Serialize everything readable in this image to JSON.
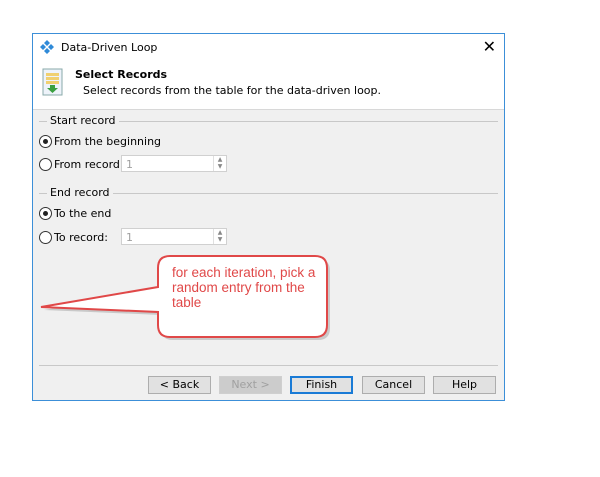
{
  "window": {
    "title": "Data-Driven Loop",
    "close": "✕"
  },
  "header": {
    "title": "Select Records",
    "subtitle": "Select records from the table for the data-driven loop."
  },
  "start": {
    "label": "Start record",
    "opt1": "From the beginning",
    "opt2": "From record:",
    "value": "1",
    "selected": "From the beginning"
  },
  "end": {
    "label": "End record",
    "opt1": "To the end",
    "opt2": "To record:",
    "value": "1",
    "selected": "To the end"
  },
  "buttons": {
    "back": "< Back",
    "next": "Next >",
    "finish": "Finish",
    "cancel": "Cancel",
    "help": "Help"
  },
  "annotation": {
    "text": "for each iteration, pick a random entry from the table",
    "color": "#e04848"
  }
}
